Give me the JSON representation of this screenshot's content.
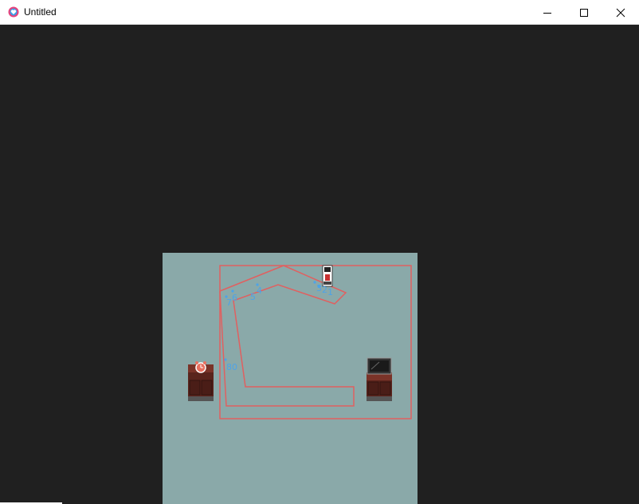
{
  "window": {
    "title": "Untitled",
    "icon": "heart-app-icon",
    "controls": [
      "minimize",
      "maximize",
      "close"
    ]
  },
  "scene": {
    "background_color": "#202020",
    "floor_color": "#8aa9a9",
    "path_color": "#e06060",
    "waypoint_color": "#4da3e8",
    "objects": [
      {
        "name": "nightstand-with-alarm-clock",
        "icon": "alarm-clock-icon"
      },
      {
        "name": "nightstand-with-tv",
        "icon": "tv-icon"
      },
      {
        "name": "character-sprite",
        "icon": "character-icon"
      }
    ],
    "waypoint_labels": {
      "wp_7": "7",
      "wp_6": "6",
      "wp_5": "5",
      "wp_4": "4",
      "wp_3": "3",
      "wp_2": "2",
      "wp_1": "1",
      "wp_8": "8",
      "wp_0": "0"
    }
  }
}
